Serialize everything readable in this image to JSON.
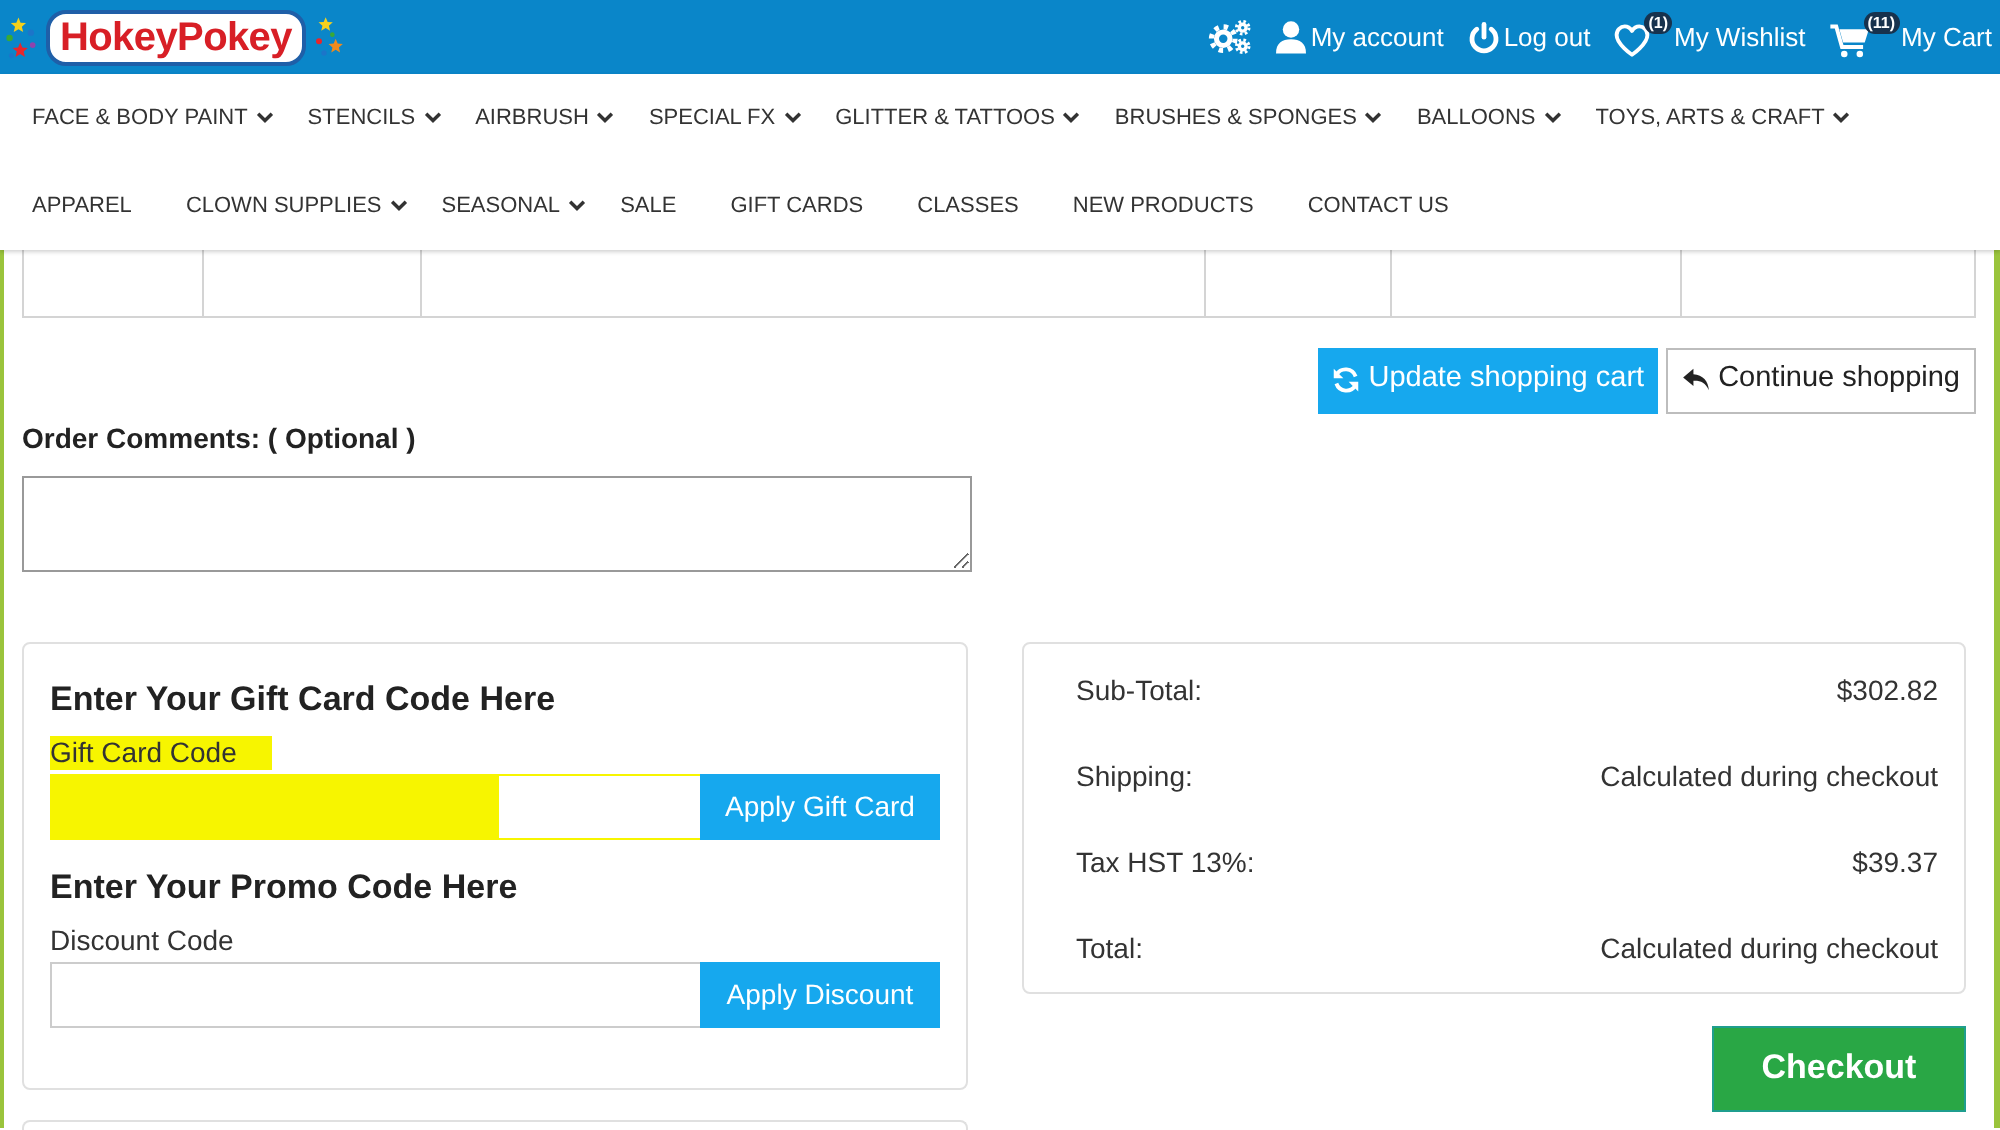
{
  "header": {
    "logo": "HokeyPokey",
    "links": [
      {
        "kind": "settings"
      },
      {
        "kind": "account",
        "label": "My account"
      },
      {
        "kind": "logout",
        "label": "Log out"
      },
      {
        "kind": "wishlist",
        "label": "My Wishlist",
        "badge": "(1)"
      },
      {
        "kind": "cart",
        "label": "My Cart",
        "badge": "(11)"
      }
    ]
  },
  "menu_rows": [
    {
      "items": [
        {
          "label": "FACE & BODY PAINT",
          "dropdown": true
        },
        {
          "label": "STENCILS",
          "dropdown": true
        },
        {
          "label": "AIRBRUSH",
          "dropdown": true
        },
        {
          "label": "SPECIAL FX",
          "dropdown": true
        },
        {
          "label": "GLITTER & TATTOOS",
          "dropdown": true
        },
        {
          "label": "BRUSHES & SPONGES",
          "dropdown": true
        },
        {
          "label": "BALLOONS",
          "dropdown": true
        },
        {
          "label": "TOYS, ARTS & CRAFT",
          "dropdown": true
        }
      ]
    },
    {
      "items": [
        {
          "label": "APPAREL",
          "dropdown": false
        },
        {
          "label": "CLOWN SUPPLIES",
          "dropdown": true
        },
        {
          "label": "SEASONAL",
          "dropdown": true
        },
        {
          "label": "SALE",
          "dropdown": false
        },
        {
          "label": "GIFT CARDS",
          "dropdown": false
        },
        {
          "label": "CLASSES",
          "dropdown": false
        },
        {
          "label": "NEW PRODUCTS",
          "dropdown": false
        },
        {
          "label": "CONTACT US",
          "dropdown": false
        }
      ]
    }
  ],
  "cart_actions": [
    {
      "kind": "update",
      "label": "Update shopping cart"
    },
    {
      "kind": "continue",
      "label": "Continue shopping"
    }
  ],
  "order_comments": {
    "label": "Order Comments: ( Optional )"
  },
  "code_forms": [
    {
      "heading": "Enter Your Gift Card Code Here",
      "label": "Gift Card Code",
      "highlighted": true,
      "button": "Apply Gift Card"
    },
    {
      "heading": "Enter Your Promo Code Here",
      "label": "Discount Code",
      "highlighted": false,
      "button": "Apply Discount"
    }
  ],
  "summary": [
    {
      "label": "Sub-Total:",
      "value": "$302.82"
    },
    {
      "label": "Shipping:",
      "value": "Calculated during checkout"
    },
    {
      "label": "Tax HST 13%:",
      "value": "$39.37"
    },
    {
      "label": "Total:",
      "value": "Calculated during checkout"
    }
  ],
  "checkout": {
    "label": "Checkout"
  }
}
